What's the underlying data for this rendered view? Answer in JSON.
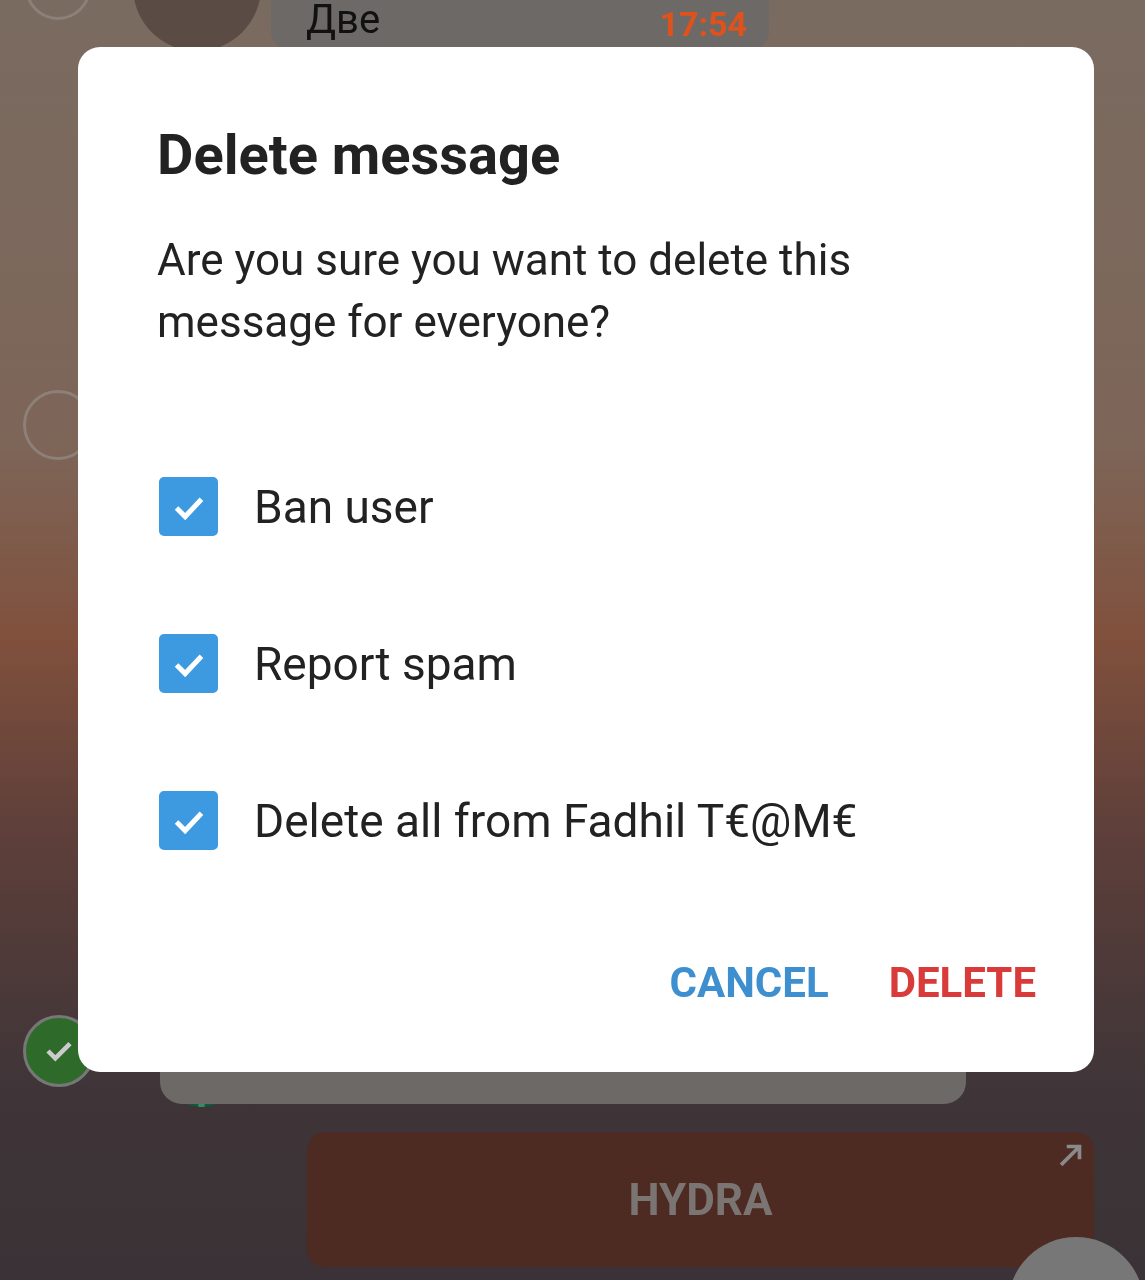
{
  "chat": {
    "top_message": {
      "text": "Две",
      "time": "17:54"
    },
    "selection_circles": [
      {
        "selected": false
      },
      {
        "selected": false
      },
      {
        "selected": true
      }
    ],
    "link_button": {
      "label": "HYDRA"
    }
  },
  "dialog": {
    "title": "Delete message",
    "message": "Are you sure you want to delete this message for everyone?",
    "options": [
      {
        "label": "Ban user",
        "checked": true
      },
      {
        "label": "Report spam",
        "checked": true
      },
      {
        "label": "Delete all from Fadhil T€@M€",
        "checked": true
      }
    ],
    "buttons": [
      {
        "label": "CANCEL",
        "kind": "cancel"
      },
      {
        "label": "DELETE",
        "kind": "delete"
      }
    ]
  }
}
